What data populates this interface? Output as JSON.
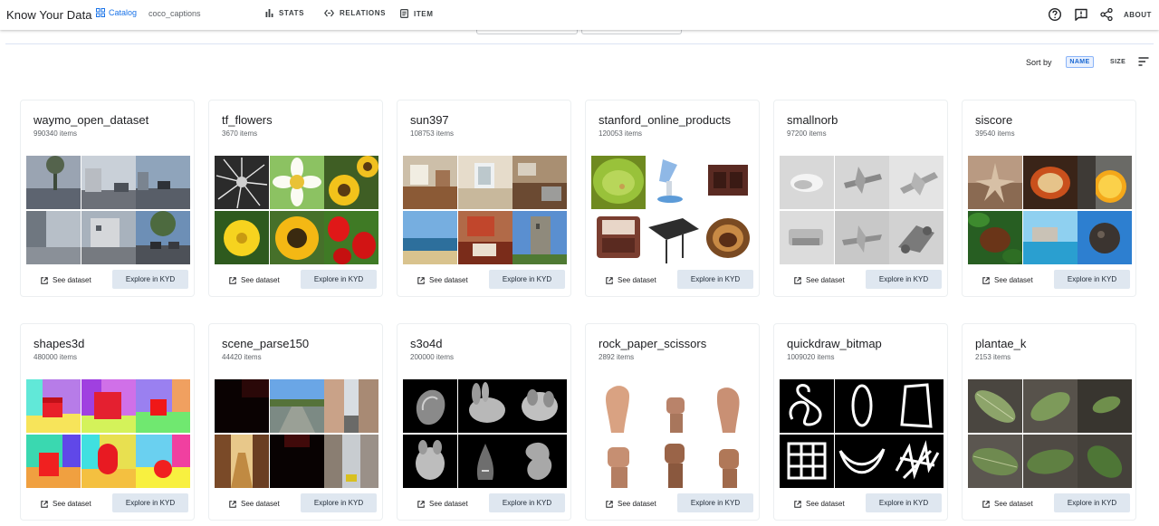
{
  "app": {
    "brand": "Know Your Data",
    "catalog_label": "Catalog",
    "current_dataset": "coco_captions"
  },
  "nav": {
    "stats": "STATS",
    "relations": "RELATIONS",
    "item": "ITEM",
    "about": "ABOUT"
  },
  "sort": {
    "label": "Sort by",
    "name": "NAME",
    "size": "SIZE"
  },
  "actions": {
    "see_dataset": "See dataset",
    "explore": "Explore in KYD"
  },
  "colors": {
    "accent": "#1a73e8",
    "explore_bg": "#dfe7f0",
    "chip_bg": "#e8f0fe"
  },
  "datasets": [
    {
      "name": "waymo_open_dataset",
      "count": "990340 items"
    },
    {
      "name": "tf_flowers",
      "count": "3670 items"
    },
    {
      "name": "sun397",
      "count": "108753 items"
    },
    {
      "name": "stanford_online_products",
      "count": "120053 items"
    },
    {
      "name": "smallnorb",
      "count": "97200 items"
    },
    {
      "name": "siscore",
      "count": "39540 items"
    },
    {
      "name": "shapes3d",
      "count": "480000 items"
    },
    {
      "name": "scene_parse150",
      "count": "44420 items"
    },
    {
      "name": "s3o4d",
      "count": "200000 items"
    },
    {
      "name": "rock_paper_scissors",
      "count": "2892 items"
    },
    {
      "name": "quickdraw_bitmap",
      "count": "1009020 items"
    },
    {
      "name": "plantae_k",
      "count": "2153 items"
    }
  ]
}
